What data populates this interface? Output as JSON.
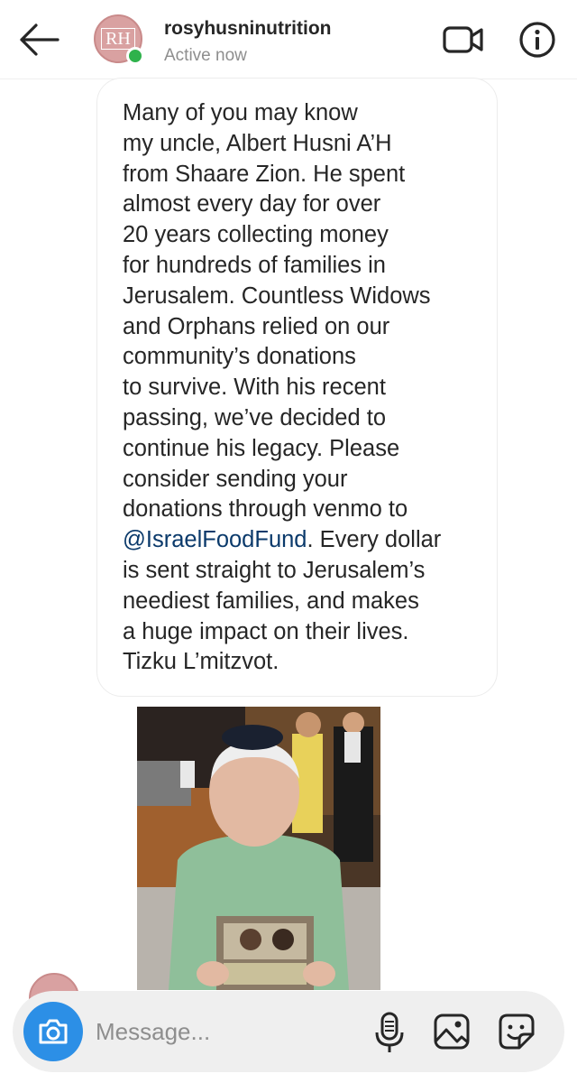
{
  "header": {
    "back_icon": "arrow-left-icon",
    "avatar_initials": "RH",
    "username": "rosyhusninutrition",
    "status": "Active now",
    "video_icon": "video-call-icon",
    "info_icon": "info-icon"
  },
  "message": {
    "lines": [
      "Many of you may know",
      "my uncle, Albert Husni A’H",
      "from Shaare Zion. He spent",
      "almost every day for over",
      "20 years collecting money",
      "for hundreds of families in",
      "Jerusalem. Countless Widows",
      "and Orphans relied on our",
      "community’s donations",
      "to survive. With his recent",
      "passing, we’ve decided to",
      "continue his legacy. Please",
      "consider sending your",
      "donations through venmo to"
    ],
    "mention": "@IsraelFoodFund",
    "mention_tail": ". Every dollar",
    "lines_after": [
      "is sent straight to Jerusalem’s",
      "neediest families, and makes",
      "a huge impact on their lives.",
      "Tizku L’mitzvot."
    ],
    "mention_color": "#0b3a6b"
  },
  "composer": {
    "placeholder": "Message...",
    "camera_icon": "camera-icon",
    "mic_icon": "microphone-icon",
    "gallery_icon": "gallery-icon",
    "sticker_icon": "sticker-icon",
    "camera_color": "#2c8fe6"
  }
}
